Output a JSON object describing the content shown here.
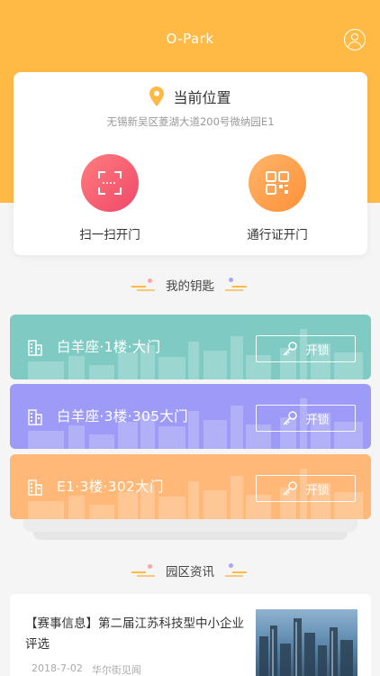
{
  "header": {
    "app_title": "O-Park",
    "avatar_icon": "user-avatar-icon"
  },
  "location": {
    "title": "当前位置",
    "address": "无锡新吴区菱湖大道200号微纳园E1",
    "pin_icon": "location-pin-icon"
  },
  "actions": [
    {
      "label": "扫一扫开门",
      "icon": "scan-icon"
    },
    {
      "label": "通行证开门",
      "icon": "qr-code-icon"
    }
  ],
  "keys_section": {
    "title": "我的钥匙"
  },
  "keys": [
    {
      "name": "白羊座·1楼·大门",
      "unlock_label": "开锁",
      "color": "#7fcbc4"
    },
    {
      "name": "白羊座·3楼·305大门",
      "unlock_label": "开锁",
      "color": "#9d9bf7"
    },
    {
      "name": "E1·3楼·302大门",
      "unlock_label": "开锁",
      "color": "#ffb877"
    }
  ],
  "news_section": {
    "title": "园区资讯"
  },
  "news": [
    {
      "title": "【赛事信息】第二届江苏科技型中小企业评选",
      "date": "2018-7-02",
      "source": "华尔街见闻"
    }
  ],
  "colors": {
    "accent": "#ffba46",
    "scan_gradient": [
      "#ff7d7d",
      "#f0486a"
    ],
    "pass_gradient": [
      "#ffb56a",
      "#ff9038"
    ]
  }
}
